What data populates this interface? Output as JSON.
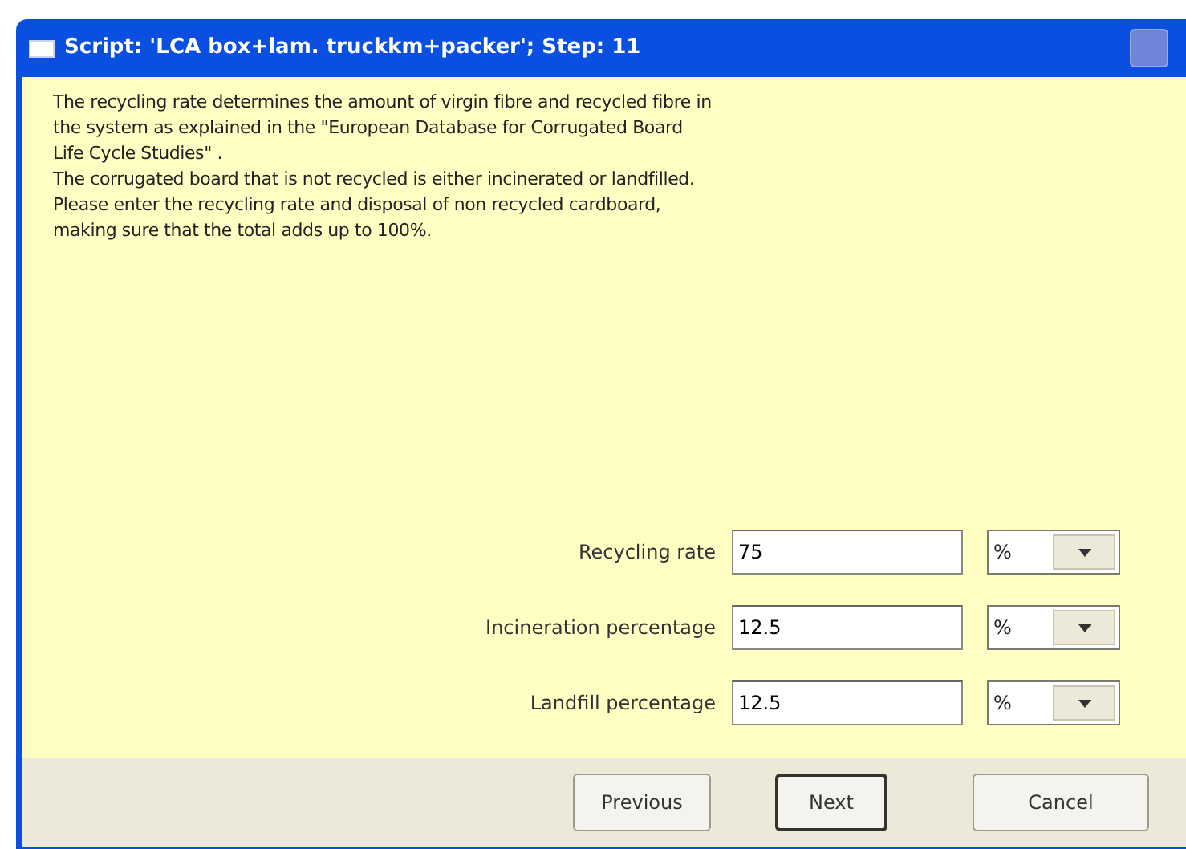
{
  "window": {
    "title": "Script: 'LCA box+lam. truckkm+packer';   Step: 11"
  },
  "description": "The recycling rate determines the amount of virgin fibre and recycled fibre in\nthe system as explained in the \"European Database for Corrugated Board\nLife Cycle Studies\" .\nThe corrugated board that is not recycled is either incinerated or landfilled.\nPlease enter the recycling rate and disposal of non recycled cardboard,\nmaking sure that the total adds up to 100%.",
  "fields": [
    {
      "label": "Recycling rate",
      "value": "75",
      "unit": "%"
    },
    {
      "label": "Incineration percentage",
      "value": "12.5",
      "unit": "%"
    },
    {
      "label": "Landfill percentage",
      "value": "12.5",
      "unit": "%"
    }
  ],
  "buttons": [
    {
      "label": "Previous",
      "default": false
    },
    {
      "label": "Next",
      "default": true
    },
    {
      "label": "Cancel",
      "default": false
    }
  ]
}
